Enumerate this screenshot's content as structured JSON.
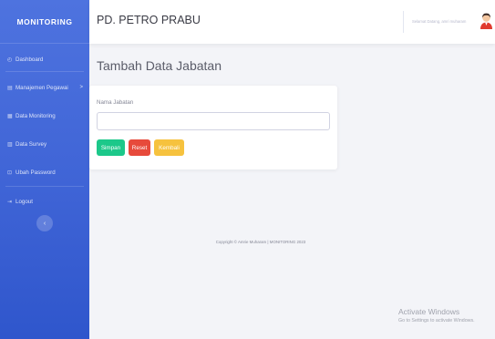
{
  "sidebar": {
    "brand": "MONITORING",
    "items": [
      {
        "label": "Dashboard",
        "icon": "dashboard-icon"
      },
      {
        "label": "Manajemen Pegawai",
        "icon": "users-icon",
        "chevron": ">"
      },
      {
        "label": "Data Monitoring",
        "icon": "table-icon"
      },
      {
        "label": "Data Survey",
        "icon": "survey-icon"
      },
      {
        "label": "Ubah Password",
        "icon": "lock-icon"
      },
      {
        "label": "Logout",
        "icon": "logout-icon"
      }
    ],
    "toggle_icon": "‹"
  },
  "topbar": {
    "company": "PD. PETRO PRABU",
    "greeting": "Selamat Datang, amri muharam"
  },
  "main": {
    "title": "Tambah Data Jabatan",
    "form": {
      "label": "Nama Jabatan",
      "value": "",
      "buttons": {
        "save": "Simpan",
        "reset": "Reset",
        "back": "Kembali"
      }
    }
  },
  "footer": {
    "copyright": "Copyright © Amrie Muharam | MONITORING 2023"
  },
  "watermark": {
    "title": "Activate Windows",
    "subtitle": "Go to Settings to activate Windows."
  },
  "colors": {
    "sidebar": "#4e73df",
    "success": "#1cc88a",
    "danger": "#e74a3b",
    "warning": "#f6c23e"
  }
}
